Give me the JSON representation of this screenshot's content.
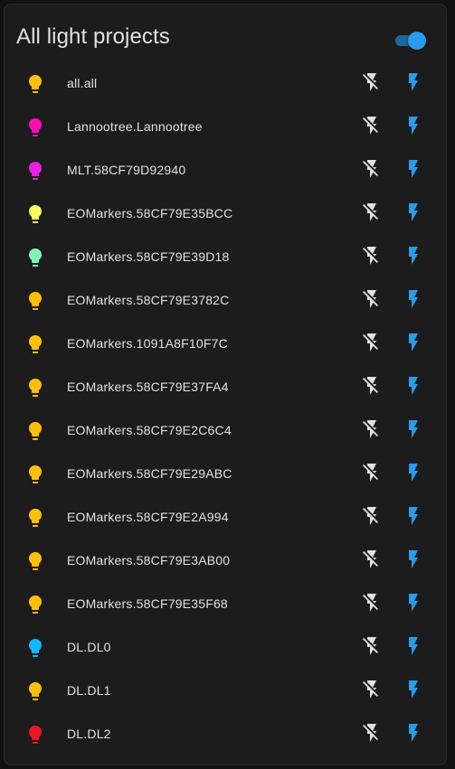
{
  "card": {
    "title": "All light projects",
    "master_toggle_on": true,
    "accent_color": "#2a9be8"
  },
  "entities": [
    {
      "name": "all.all",
      "color": "#fdc00a"
    },
    {
      "name": "Lannootree.Lannootree",
      "color": "#f60eb4"
    },
    {
      "name": "MLT.58CF79D92940",
      "color": "#ea22e4"
    },
    {
      "name": "EOMarkers.58CF79E35BCC",
      "color": "#f5fb5f"
    },
    {
      "name": "EOMarkers.58CF79E39D18",
      "color": "#7ff6b0"
    },
    {
      "name": "EOMarkers.58CF79E3782C",
      "color": "#fdc00a"
    },
    {
      "name": "EOMarkers.1091A8F10F7C",
      "color": "#fdc00a"
    },
    {
      "name": "EOMarkers.58CF79E37FA4",
      "color": "#fdc00a"
    },
    {
      "name": "EOMarkers.58CF79E2C6C4",
      "color": "#fdc00a"
    },
    {
      "name": "EOMarkers.58CF79E29ABC",
      "color": "#fdc00a"
    },
    {
      "name": "EOMarkers.58CF79E2A994",
      "color": "#fdc00a"
    },
    {
      "name": "EOMarkers.58CF79E3AB00",
      "color": "#fdc00a"
    },
    {
      "name": "EOMarkers.58CF79E35F68",
      "color": "#fdc00a"
    },
    {
      "name": "DL.DL0",
      "color": "#12b7f7"
    },
    {
      "name": "DL.DL1",
      "color": "#fdc00a"
    },
    {
      "name": "DL.DL2",
      "color": "#ee1528"
    }
  ],
  "icons": {
    "entity": "lightbulb-icon",
    "off_button": "flash-off-icon",
    "on_button": "flash-icon",
    "off_color": "#e1e1e1",
    "on_color": "#2a9be8"
  }
}
